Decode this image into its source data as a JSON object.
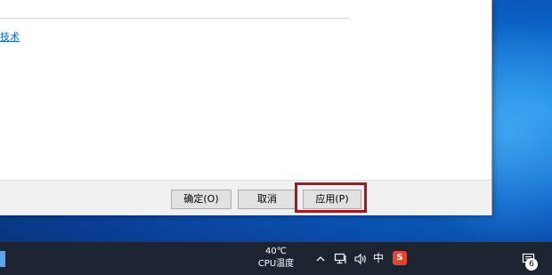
{
  "dialog": {
    "link_text": "技术",
    "buttons": {
      "ok_label": "确定(O)",
      "cancel_label": "取消",
      "apply_label": "应用(P)"
    },
    "highlight_color": "#b3121b"
  },
  "taskbar": {
    "temperature": "40℃",
    "temperature_label": "CPU温度",
    "ime_label": "中",
    "sogou_label": "S",
    "notification_count": "6"
  },
  "colors": {
    "taskbar": "#1b2430",
    "desktop": "#0a5fc4",
    "link": "#0066cc"
  }
}
